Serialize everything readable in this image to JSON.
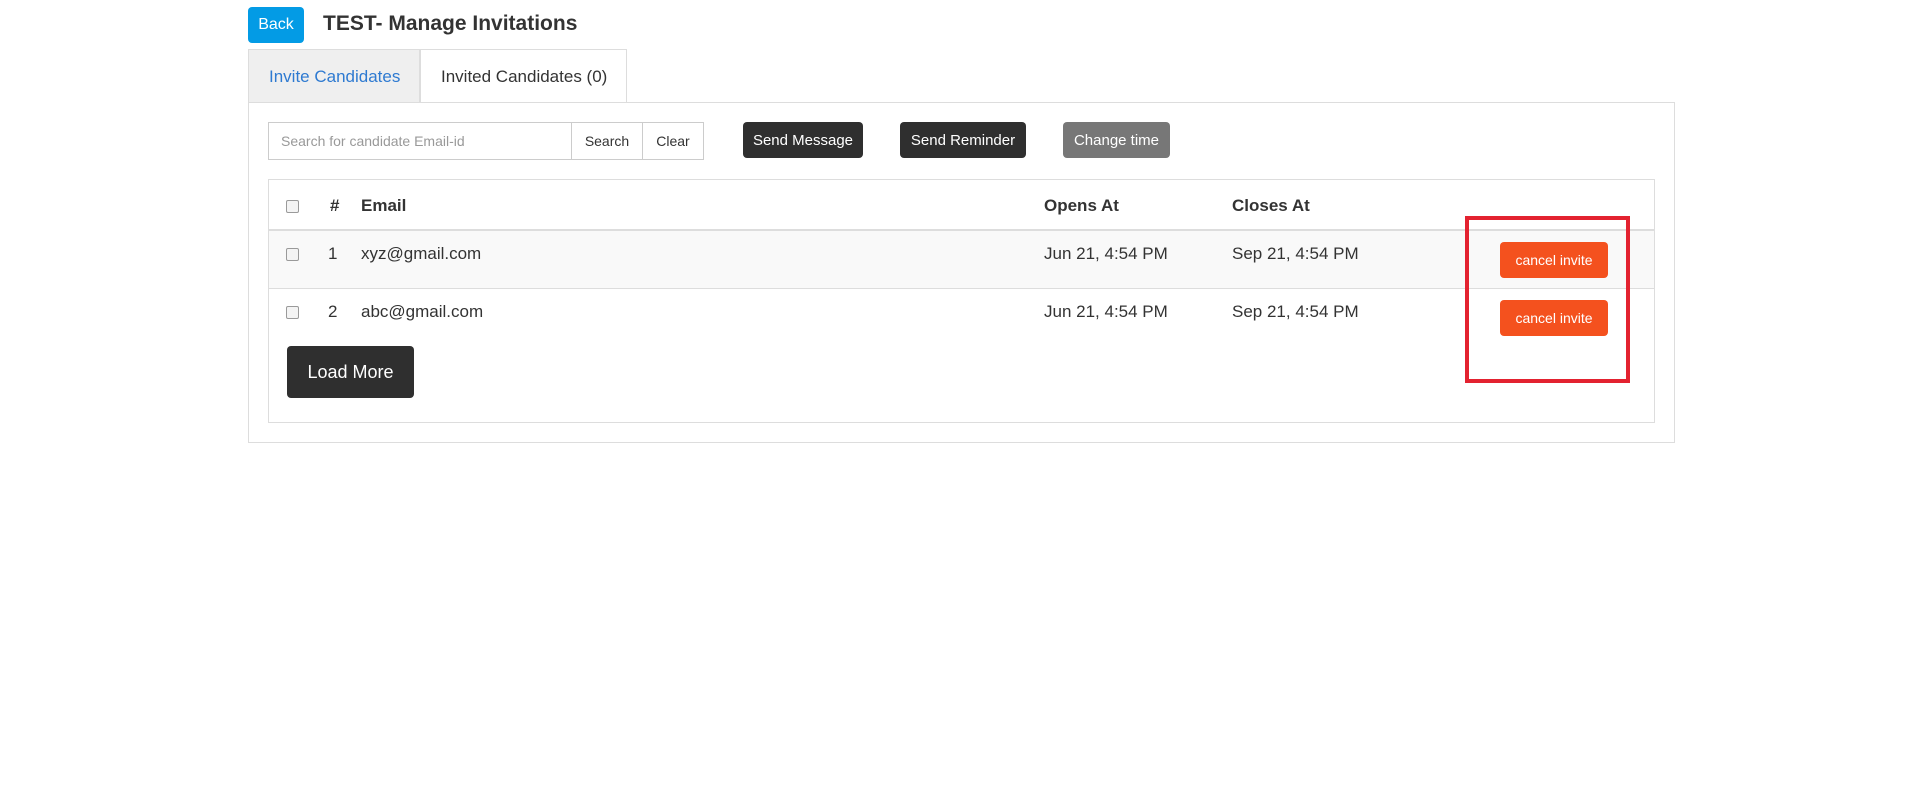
{
  "header": {
    "back_label": "Back",
    "title": "TEST- Manage Invitations"
  },
  "tabs": [
    {
      "label": "Invite Candidates",
      "active": false
    },
    {
      "label": "Invited Candidates (0)",
      "active": true
    }
  ],
  "toolbar": {
    "search_placeholder": "Search for candidate Email-id",
    "search_value": "",
    "search_label": "Search",
    "clear_label": "Clear",
    "send_message_label": "Send Message",
    "send_reminder_label": "Send Reminder",
    "change_time_label": "Change time"
  },
  "table": {
    "columns": [
      "#",
      "Email",
      "Opens At",
      "Closes At"
    ],
    "rows": [
      {
        "num": "1",
        "email": "xyz@gmail.com",
        "opens_at": "Jun 21, 4:54 PM",
        "closes_at": "Sep 21, 4:54 PM",
        "action_label": "cancel invite"
      },
      {
        "num": "2",
        "email": "abc@gmail.com",
        "opens_at": "Jun 21, 4:54 PM",
        "closes_at": "Sep 21, 4:54 PM",
        "action_label": "cancel invite"
      }
    ]
  },
  "load_more_label": "Load More",
  "colors": {
    "primary_blue": "#039be5",
    "link_blue": "#2e7ad1",
    "dark_button": "#2f2f2f",
    "disabled_button": "#777777",
    "cancel_orange": "#f4511e",
    "highlight_red": "#e32230"
  }
}
